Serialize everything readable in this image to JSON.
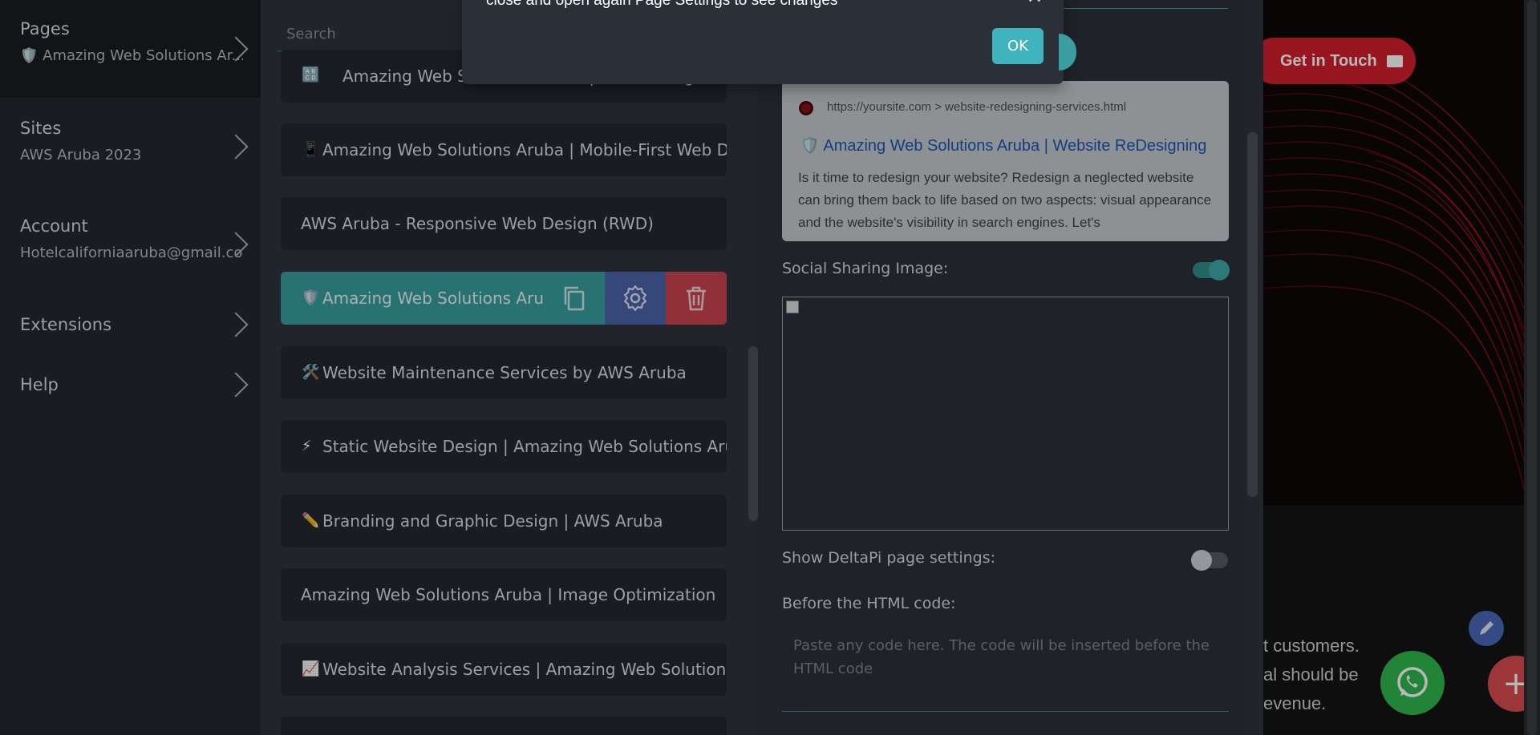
{
  "menu": {
    "items": [
      {
        "title": "Pages",
        "subtitle": "🛡️ Amazing Web Solutions Ar..."
      },
      {
        "title": "Sites",
        "subtitle": "AWS Aruba 2023"
      },
      {
        "title": "Account",
        "subtitle": "Hotelcaliforniaaruba@gmail.com"
      },
      {
        "title": "Extensions",
        "subtitle": ""
      },
      {
        "title": "Help",
        "subtitle": ""
      }
    ]
  },
  "pages": {
    "search_placeholder": "Search",
    "rows": [
      {
        "emoji": "🔠",
        "label": "Amazing Web Solutions Aruba | UI/UX Design"
      },
      {
        "emoji": "📱",
        "label": "Amazing Web Solutions Aruba | Mobile-First Web Design"
      },
      {
        "emoji": "",
        "label": "AWS Aruba - Responsive Web Design (RWD)"
      },
      {
        "emoji": "🛡️",
        "label": "Amazing Web Solutions Aruba |"
      },
      {
        "emoji": "🛠️",
        "label": "Website Maintenance Services by AWS Aruba"
      },
      {
        "emoji": "⚡",
        "label": "Static Website Design | Amazing Web Solutions Aruba"
      },
      {
        "emoji": "✏️",
        "label": "Branding and Graphic Design | AWS Aruba"
      },
      {
        "emoji": "",
        "label": "Amazing Web Solutions Aruba | Image Optimization"
      },
      {
        "emoji": "📈",
        "label": "Website Analysis Services | Amazing Web Solutions Aruba"
      }
    ]
  },
  "settings": {
    "seo_preview": {
      "url": "https://yoursite.com > website-redesigning-services.html",
      "title": "🛡️ Amazing Web Solutions Aruba | Website ReDesigning",
      "description": "Is it time to redesign your website? Redesign a neglected website can bring them back to life based on two aspects: visual appearance and the website's visibility in search engines. Let's"
    },
    "social_image_label": "Social Sharing Image:",
    "social_image_enabled": true,
    "deltapi_label": "Show DeltaPi page settings:",
    "deltapi_enabled": false,
    "before_html_label": "Before the HTML code:",
    "before_html_placeholder": "Paste any code here. The code will be inserted before the HTML code"
  },
  "site_preview": {
    "cta_label": "Get in Touch",
    "text_lines": [
      "t customers.",
      "al should be",
      "evenue."
    ]
  },
  "modal": {
    "message": "close and open again Page Settings to see changes",
    "close_label": "✕",
    "ok_label": "OK"
  },
  "colors": {
    "accent": "#3a9ea0",
    "danger": "#c9434f",
    "settings_button": "#4b63a9",
    "cta": "#d31f2b",
    "whatsapp": "#2fb84d"
  }
}
